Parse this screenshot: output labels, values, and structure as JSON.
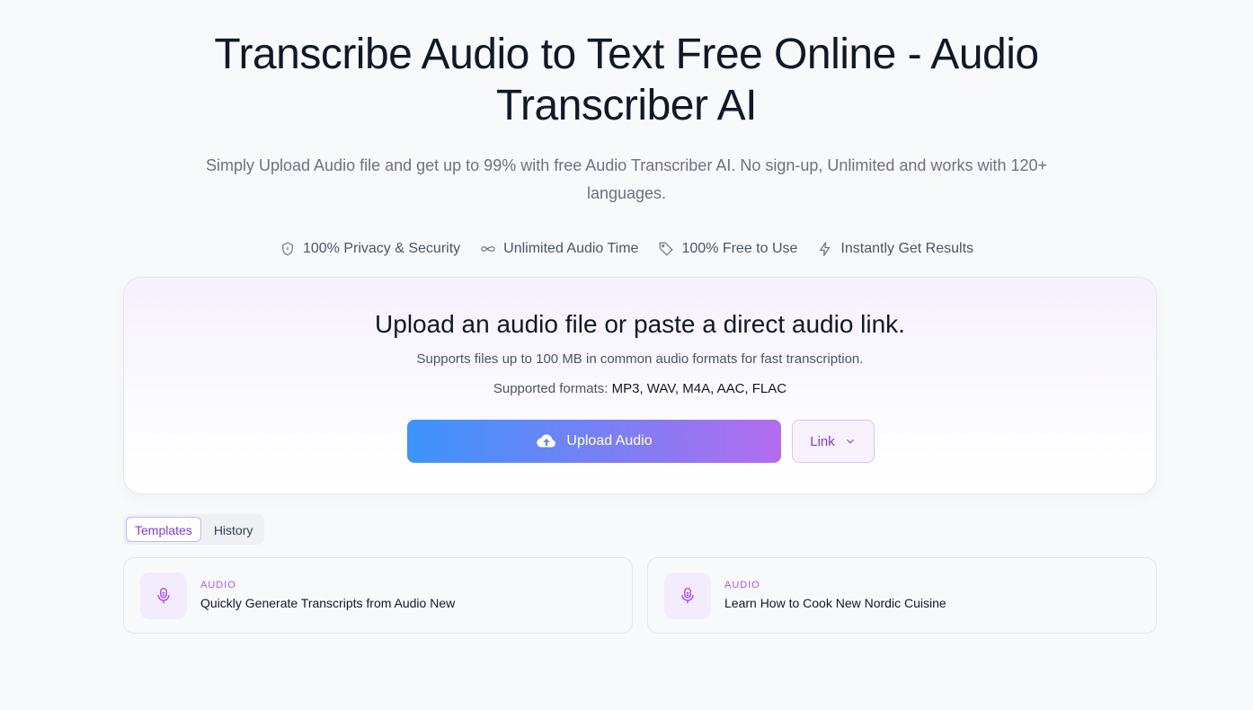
{
  "hero": {
    "title": "Transcribe Audio to Text Free Online - Audio Transcriber AI",
    "subtitle": "Simply Upload Audio file and get up to 99% with free Audio Transcriber AI. No sign-up, Unlimited and works with 120+ languages."
  },
  "features": [
    {
      "icon": "shield-icon",
      "label": "100% Privacy & Security"
    },
    {
      "icon": "infinity-icon",
      "label": "Unlimited Audio Time"
    },
    {
      "icon": "tag-icon",
      "label": "100% Free to Use"
    },
    {
      "icon": "lightning-icon",
      "label": "Instantly Get Results"
    }
  ],
  "upload": {
    "title": "Upload an audio file or paste a direct audio link.",
    "description": "Supports files up to 100 MB in common audio formats for fast transcription.",
    "formats_label": "Supported formats:",
    "formats_value": "MP3, WAV, M4A, AAC, FLAC",
    "upload_button": "Upload Audio",
    "link_button": "Link"
  },
  "tabs": [
    {
      "label": "Templates",
      "active": true
    },
    {
      "label": "History",
      "active": false
    }
  ],
  "templates": [
    {
      "tag": "AUDIO",
      "title": "Quickly Generate Transcripts from Audio New"
    },
    {
      "tag": "AUDIO",
      "title": "Learn How to Cook New Nordic Cuisine"
    }
  ],
  "colors": {
    "accent": "#7c3aed",
    "gradient_start": "#3b94fb",
    "gradient_end": "#b36cf0",
    "background": "#f8f9fb"
  }
}
